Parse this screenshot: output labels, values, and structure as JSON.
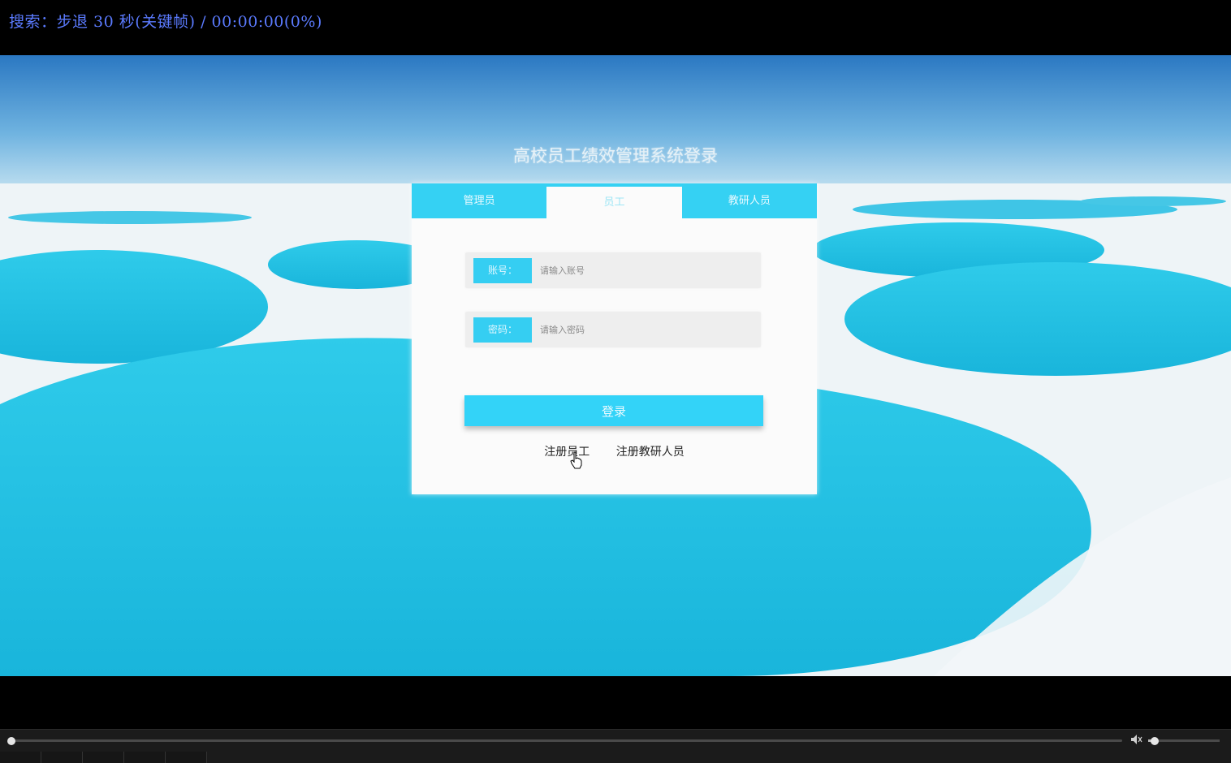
{
  "osd": {
    "text": "搜索：步退 30 秒(关键帧) / 00:00:00(0%)"
  },
  "login": {
    "title": "高校员工绩效管理系统登录",
    "tabs": [
      {
        "label": "管理员",
        "active": false
      },
      {
        "label": "员工",
        "active": true
      },
      {
        "label": "教研人员",
        "active": false
      }
    ],
    "account_label": "账号：",
    "account_placeholder": "请输入账号",
    "password_label": "密码：",
    "password_placeholder": "请输入密码",
    "login_button": "登录",
    "register_employee": "注册员工",
    "register_researcher": "注册教研人员"
  },
  "player": {
    "seek_progress": 0,
    "volume": 0.05
  },
  "colors": {
    "accent": "#35d1f3",
    "osd": "#5b7bff"
  }
}
